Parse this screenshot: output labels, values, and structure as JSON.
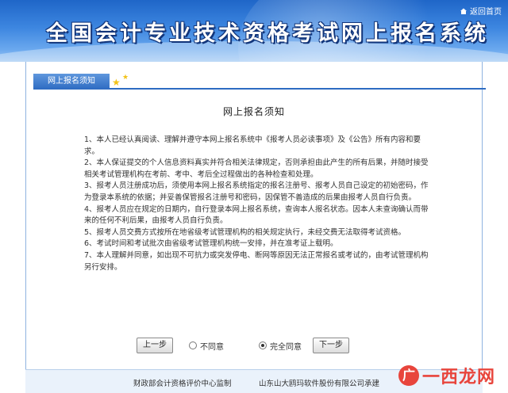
{
  "header": {
    "title": "全国会计专业技术资格考试网上报名系统",
    "back_label": "返回首页",
    "back_icon": "home-icon"
  },
  "tab": {
    "label": "网上报名须知",
    "star_icon": "star-icon"
  },
  "notice": {
    "title": "网上报名须知",
    "items": [
      "1、本人已经认真阅读、理解并遵守本网上报名系统中《报考人员必读事项》及《公告》所有内容和要求。",
      "2、本人保证提交的个人信息资料真实并符合相关法律规定，否则承担由此产生的所有后果，并随时接受相关考试管理机构在考前、考中、考后全过程做出的各种检查和处理。",
      "3、报考人员注册成功后，须使用本网上报名系统指定的报名注册号、报考人员自己设定的初始密码，作为登录本系统的依据；并妥善保管报名注册号和密码，因保管不善造成的后果由报考人员自行负责。",
      "4、报考人员应在规定的日期内，自行登录本网上报名系统，查询本人报名状态。因本人未查询确认而带来的任何不利后果，由报考人员自行负责。",
      "5、报考人员交费方式按所在地省级考试管理机构的相关规定执行，未经交费无法取得考试资格。",
      "6、考试时间和考试批次由省级考试管理机构统一安排，并在准考证上载明。",
      "7、本人理解并同意，如出现不可抗力或突发停电、断网等原因无法正常报名或考试的，由考试管理机构另行安排。"
    ]
  },
  "actions": {
    "prev_label": "上一步",
    "disagree_label": "不同意",
    "agree_label": "完全同意",
    "next_label": "下一步",
    "selected": "agree"
  },
  "footer": {
    "left": "财政部会计资格评价中心监制",
    "right": "山东山大鸥玛软件股份有限公司承建"
  },
  "watermark": {
    "logo": "广",
    "text": "一西龙网"
  },
  "colors": {
    "banner": "#2d6bc2",
    "tab": "#2d6bc2",
    "footer_bg": "#eaf2fb",
    "watermark": "#e8453c",
    "star": "#f2c318"
  }
}
